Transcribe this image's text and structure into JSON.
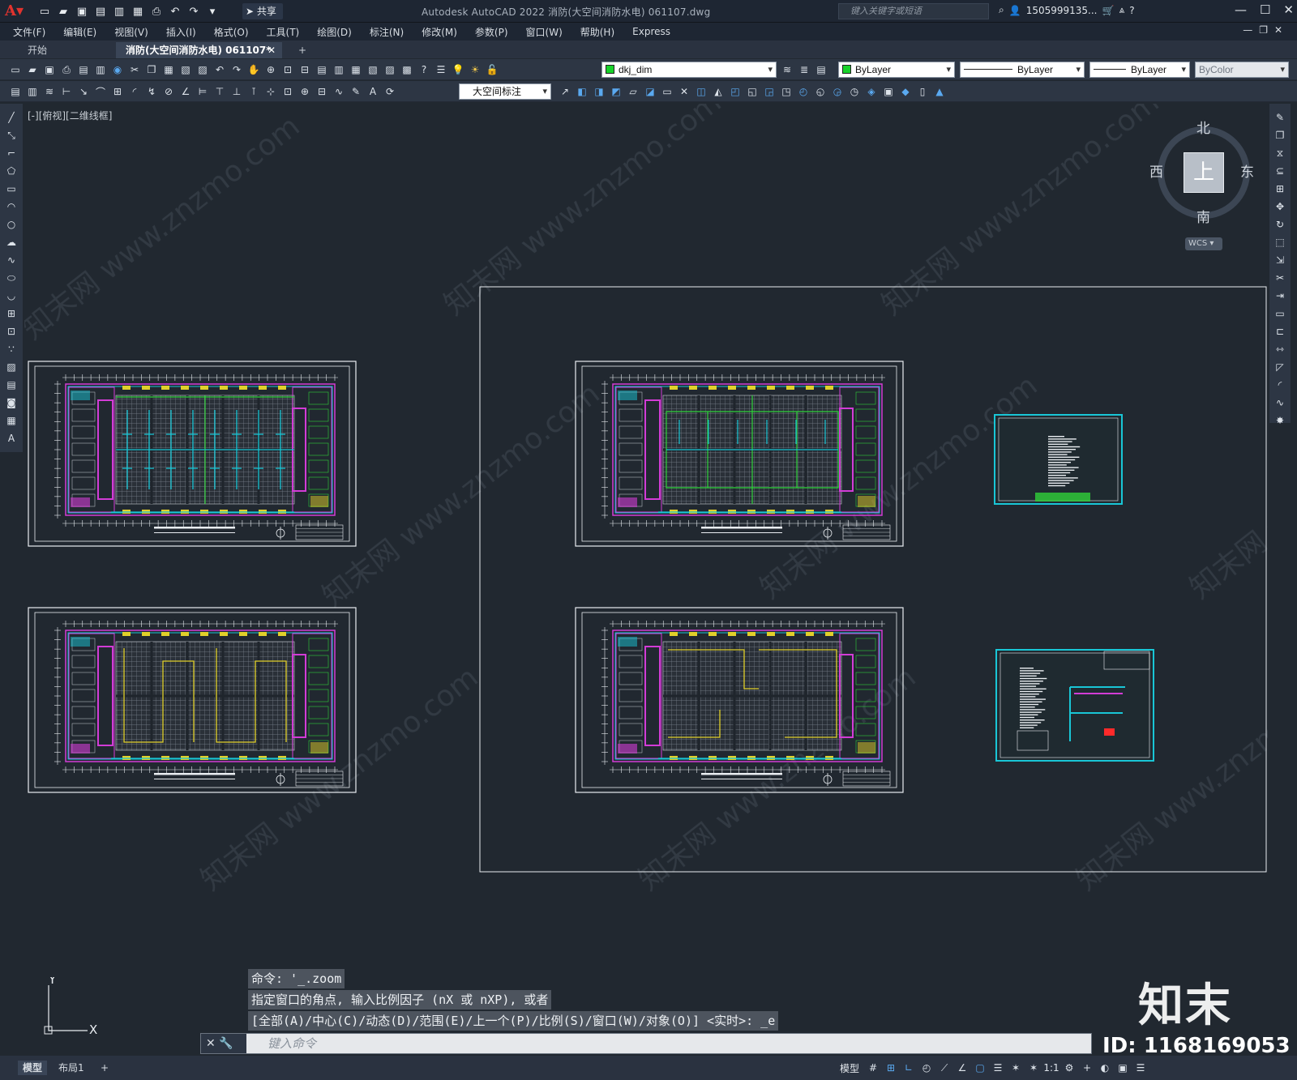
{
  "titlebar": {
    "app_title": "Autodesk AutoCAD 2022    消防(大空间消防水电) 061107.dwg",
    "share_label": "共享",
    "search_placeholder": "键入关键字或短语",
    "user": "1505999135...",
    "logo_letter": "A"
  },
  "menu": {
    "items": [
      "文件(F)",
      "编辑(E)",
      "视图(V)",
      "插入(I)",
      "格式(O)",
      "工具(T)",
      "绘图(D)",
      "标注(N)",
      "修改(M)",
      "参数(P)",
      "窗口(W)",
      "帮助(H)",
      "Express"
    ]
  },
  "tabs": {
    "start": "开始",
    "file": "消防(大空间消防水电) 061107*",
    "close": "✕",
    "add": "+"
  },
  "toolbar": {
    "layer_name": "dkj_dim",
    "color": "ByLayer",
    "linetype": "ByLayer",
    "lineweight": "ByLayer",
    "plotstyle": "ByColor",
    "dimstyle": "大空间标注",
    "layer_color": "#18d22b"
  },
  "viewport": {
    "label": "[-][俯视][二维线框]"
  },
  "viewcube": {
    "north": "北",
    "south": "南",
    "east": "东",
    "west": "西",
    "face": "上",
    "wcs": "WCS"
  },
  "command": {
    "history": [
      "命令: '_.zoom",
      "指定窗口的角点, 输入比例因子 (nX 或 nXP), 或者",
      "[全部(A)/中心(C)/动态(D)/范围(E)/上一个(P)/比例(S)/窗口(W)/对象(O)] <实时>: _e"
    ],
    "placeholder": "键入命令"
  },
  "ucs": {
    "x": "X",
    "y": "Y"
  },
  "statusbar": {
    "model_tab": "模型",
    "layout_tab": "布局1",
    "add_tab": "+",
    "model_button": "模型",
    "scale": "1:1"
  },
  "watermark": {
    "brand": "知末",
    "id": "ID: 1168169053",
    "site": "知末网 www.znzmo.com"
  },
  "colors": {
    "background": "#212830",
    "plan_magenta": "#d23cd6",
    "plan_cyan": "#19c6d6",
    "plan_green": "#2fd13a",
    "plan_yellow": "#e1d02a"
  }
}
